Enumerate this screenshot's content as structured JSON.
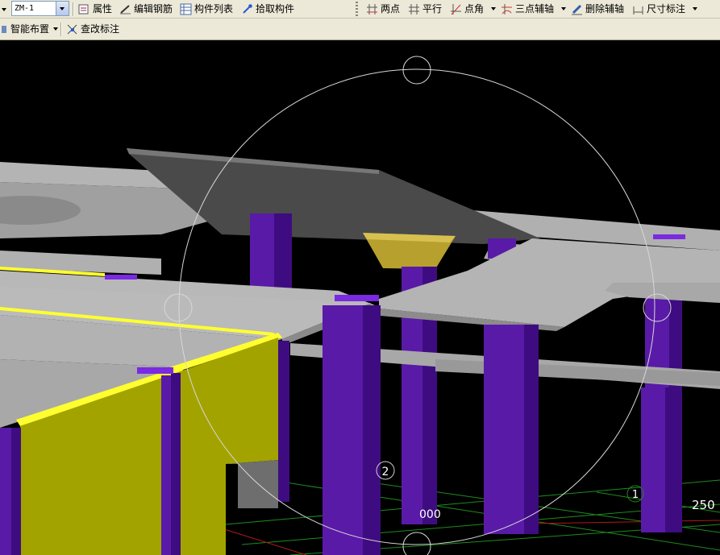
{
  "toolbar_top": {
    "component_select_value": "ZM-1",
    "buttons": {
      "properties": "属性",
      "edit_rebar": "编辑钢筋",
      "component_list": "构件列表",
      "pick_component": "拾取构件",
      "two_points": "两点",
      "parallel": "平行",
      "point_angle": "点角",
      "three_point_axis": "三点辅轴",
      "delete_axis": "删除辅轴",
      "dimension": "尺寸标注"
    }
  },
  "toolbar_second": {
    "buttons": {
      "smart_layout": "智能布置",
      "check_annotation": "查改标注"
    }
  },
  "viewport": {
    "axis_labels": {
      "axis_2": "2",
      "axis_1": "1",
      "dim_a": "000",
      "dim_b": "250"
    },
    "colors": {
      "background": "#000000",
      "column": "#5a1aa8",
      "slab": "#a8a8a8",
      "beam": "#a3a300",
      "pile_cap": "#b8a02e",
      "orbit_ring": "#d0d0d0",
      "grid": "#1e8c1e"
    }
  }
}
